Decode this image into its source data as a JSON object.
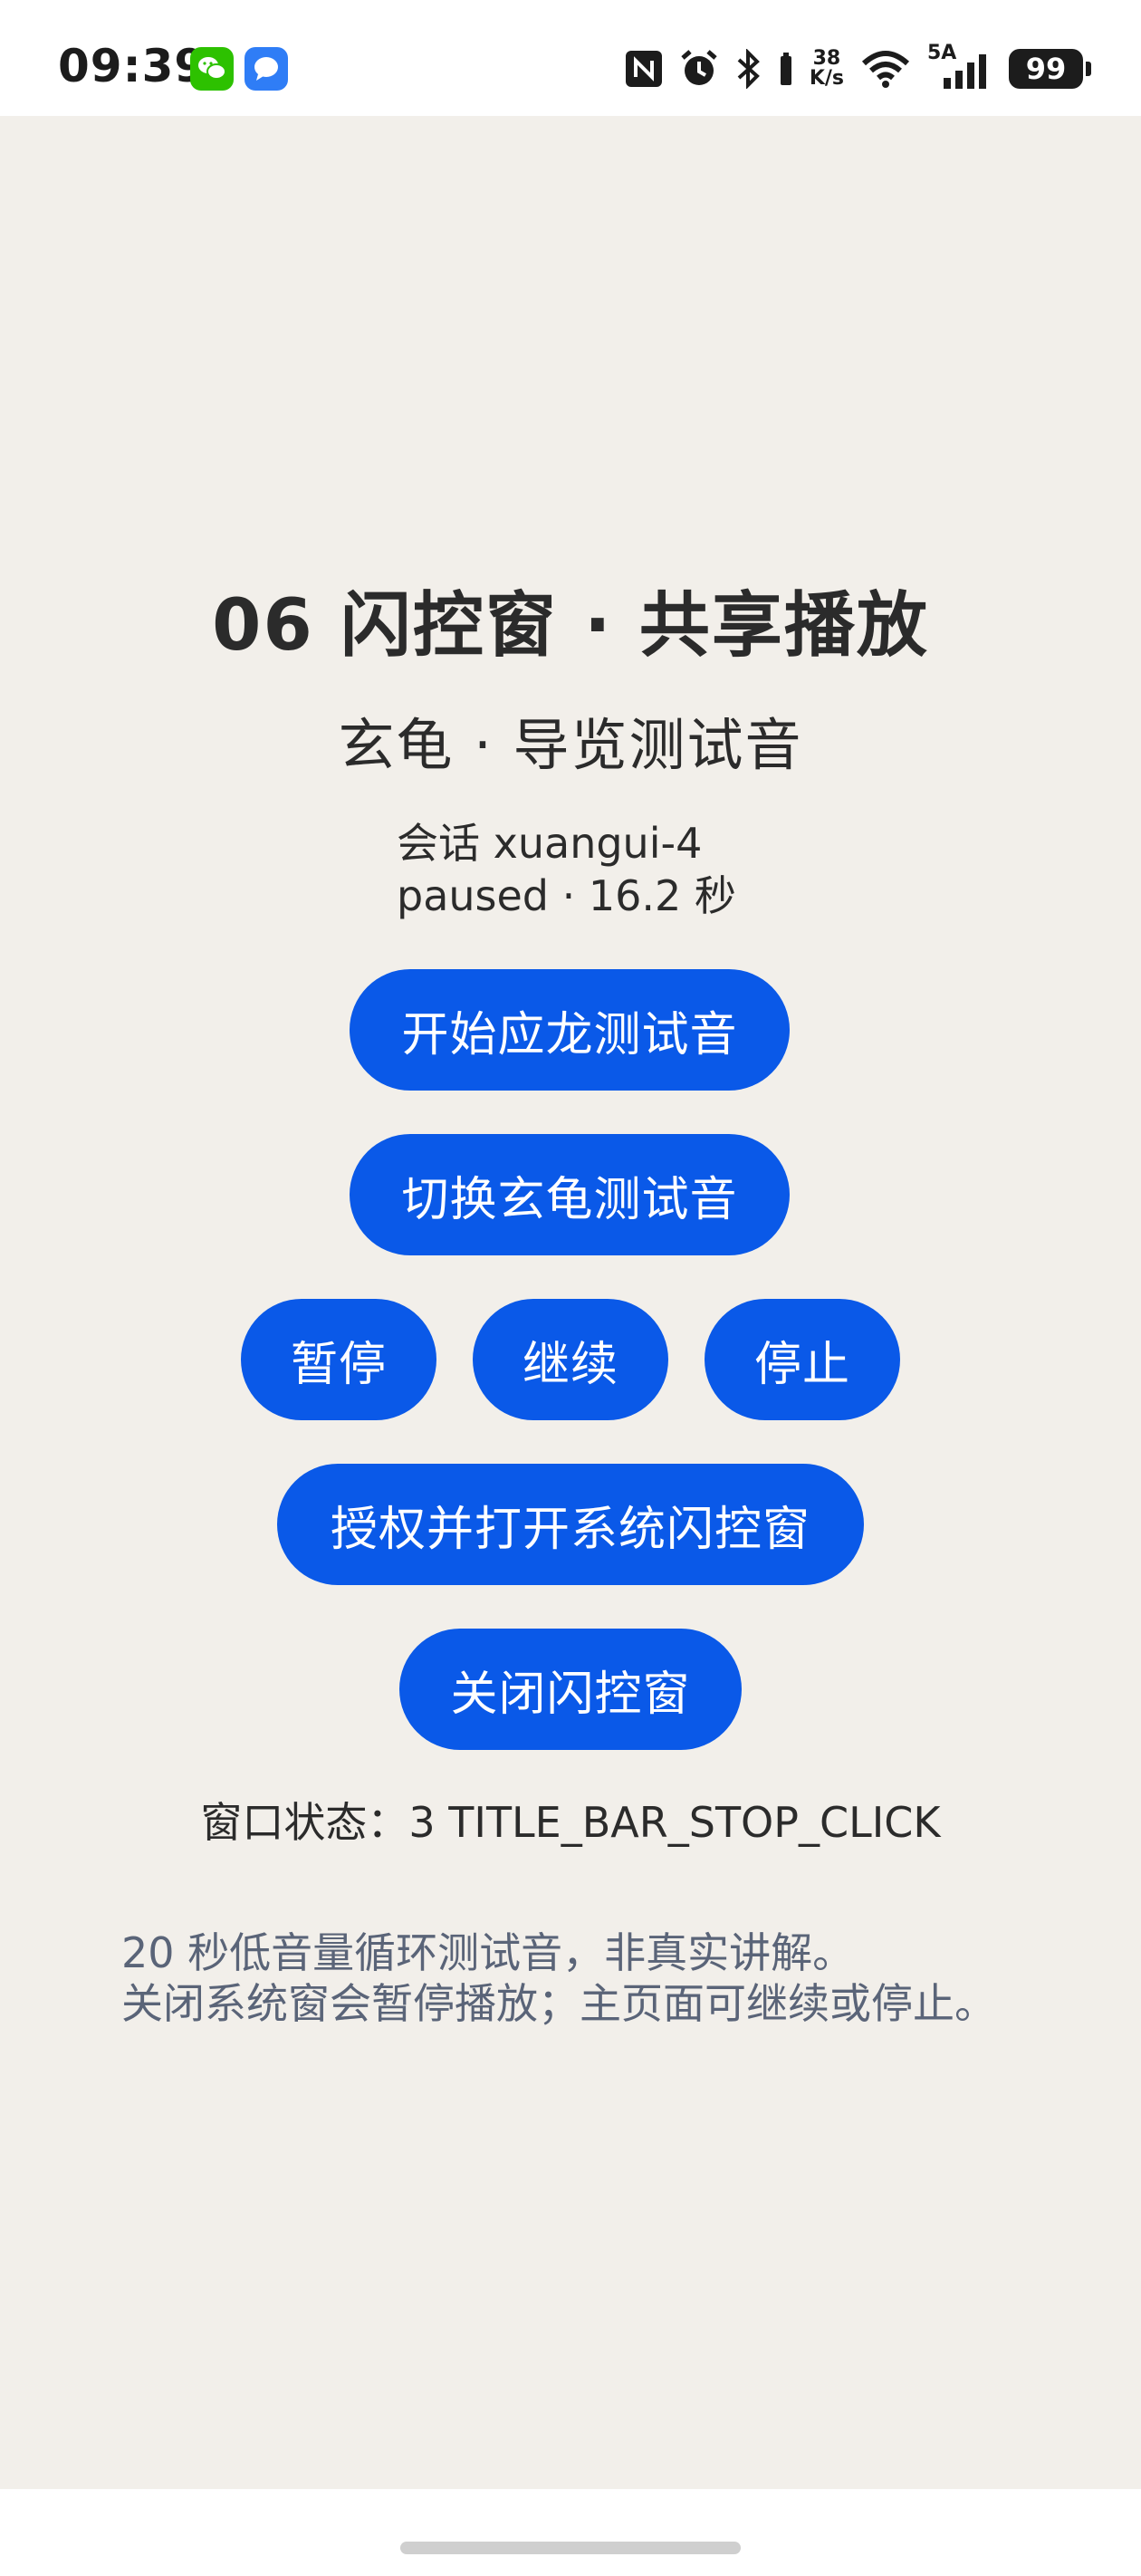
{
  "status_bar": {
    "time": "09:39",
    "net_speed_value": "38",
    "net_speed_unit": "K/s",
    "network_type": "5A",
    "battery": "99",
    "icons": [
      "wechat-icon",
      "message-icon",
      "nfc-icon",
      "alarm-icon",
      "bluetooth-icon",
      "wifi-icon",
      "cellular-signal-icon",
      "battery-icon"
    ]
  },
  "page": {
    "title": "06 闪控窗 · 共享播放",
    "subtitle": "玄龟 · 导览测试音",
    "session_line": "会话 xuangui-4",
    "playback_line": "paused · 16.2 秒",
    "window_state": "窗口状态：3 TITLE_BAR_STOP_CLICK",
    "note_line1": "20 秒低音量循环测试音，非真实讲解。",
    "note_line2": "关闭系统窗会暂停播放；主页面可继续或停止。"
  },
  "buttons": {
    "start": "开始应龙测试音",
    "switch": "切换玄龟测试音",
    "pause": "暂停",
    "resume": "继续",
    "stop": "停止",
    "authorize": "授权并打开系统闪控窗",
    "close": "关闭闪控窗"
  },
  "colors": {
    "background": "#f2efea",
    "button": "#0a59e8",
    "note_text": "#5a6478"
  }
}
